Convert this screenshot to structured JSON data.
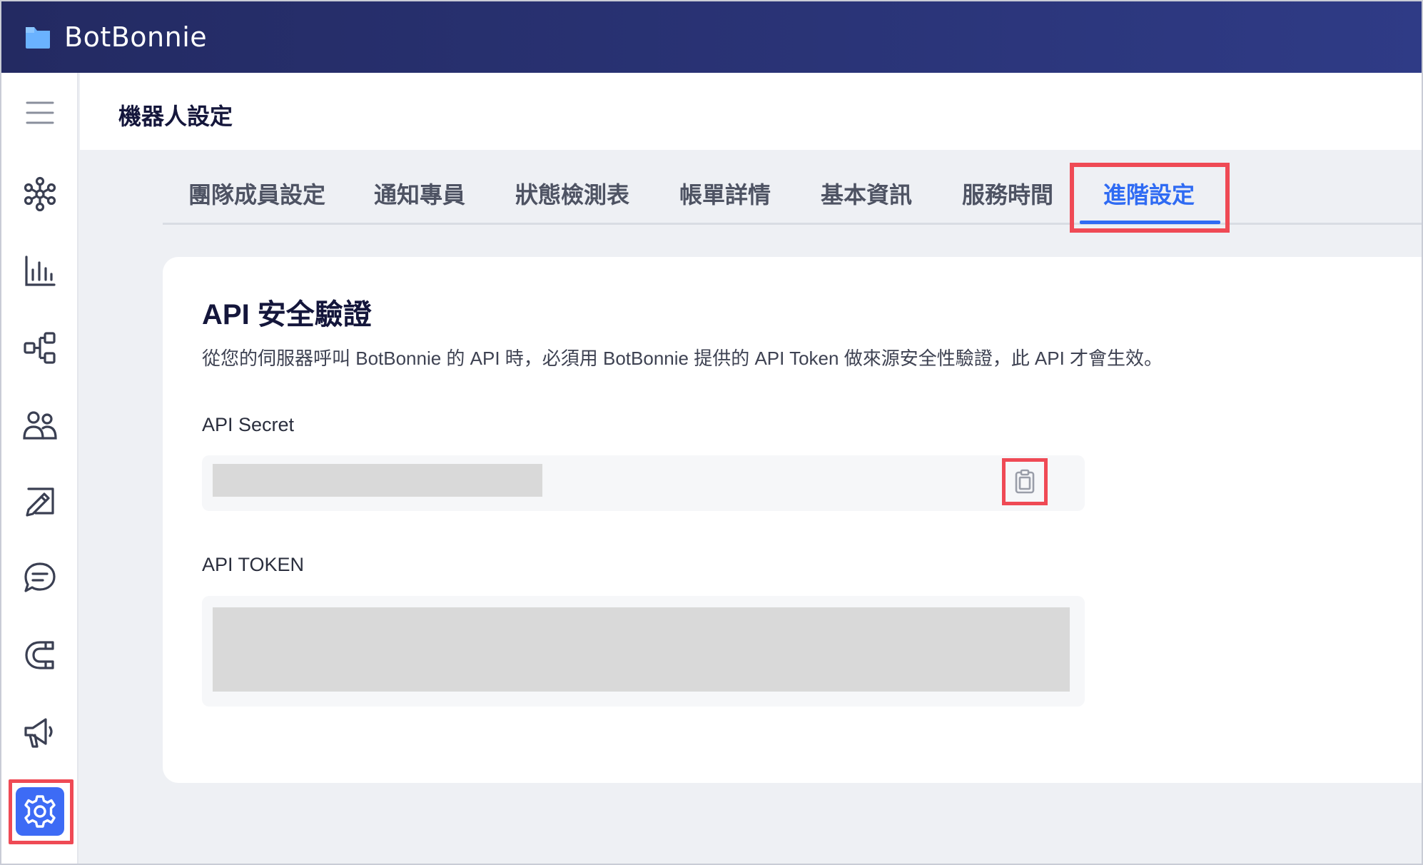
{
  "app": {
    "brand": "BotBonnie",
    "brand_color": "#2a3475",
    "accent": "#2f6bf3",
    "highlight": "#ef4a55"
  },
  "sidebar": {
    "items": [
      {
        "icon": "menu-icon"
      },
      {
        "icon": "network-icon"
      },
      {
        "icon": "bar-chart-icon"
      },
      {
        "icon": "flow-icon"
      },
      {
        "icon": "users-icon"
      },
      {
        "icon": "edit-board-icon"
      },
      {
        "icon": "chat-icon"
      },
      {
        "icon": "magnet-icon"
      },
      {
        "icon": "megaphone-icon"
      },
      {
        "icon": "gear-icon",
        "active": true
      }
    ]
  },
  "header": {
    "title": "機器人設定"
  },
  "tabs": [
    {
      "label": "團隊成員設定"
    },
    {
      "label": "通知專員"
    },
    {
      "label": "狀態檢測表"
    },
    {
      "label": "帳單詳情"
    },
    {
      "label": "基本資訊"
    },
    {
      "label": "服務時間"
    },
    {
      "label": "進階設定",
      "active": true
    }
  ],
  "card": {
    "title": "API 安全驗證",
    "description": "從您的伺服器呼叫 BotBonnie 的 API 時，必須用 BotBonnie 提供的 API Token 做來源安全性驗證，此 API 才會生效。",
    "secret_label": "API Secret",
    "token_label": "API TOKEN",
    "copy_icon": "clipboard-icon"
  }
}
